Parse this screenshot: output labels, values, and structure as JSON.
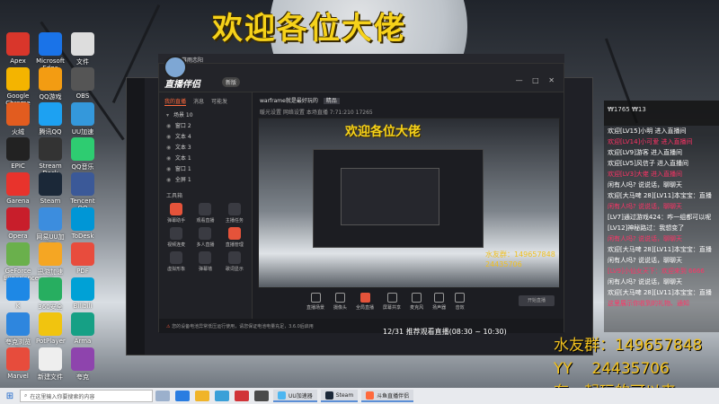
{
  "overlay": {
    "title": "欢迎各位大佬"
  },
  "fans": {
    "group_label": "水友群：",
    "group_number": "149657848",
    "yy_label": "YY",
    "yy_number": "24435706",
    "slogan": "有一起玩的可以来"
  },
  "chat": {
    "header": "₩1765 ₩13",
    "messages": [
      "欢迎[LV15]小明 进入直播间",
      "欢迎[LV14]小可爱 进入直播间",
      "欢迎[LV9]游客 进入直播间",
      "欢迎[LV5]风信子 进入直播间",
      "欢迎[LV3]大佬 进入直播间",
      "闲有人吗? 说说话，聊聊天",
      "欢迎[大马啤 28][LV11]本宝宝：直播",
      "闲有人吗? 说说话，聊聊天",
      "[LV7]通过游戏424：咋一组都可以呢",
      "[LV12]神秘路过：我想变了",
      "闲有人吗? 说说话，聊聊天",
      "欢迎[大马啤 28][LV11]本宝宝：直播",
      "闲有人吗? 说说话，聊聊天",
      "[LV9]小仙女天下：欢迎来到 6666",
      "闲有人吗? 说说话，聊聊天",
      "欢迎[大马啤 28][LV11]本宝宝：直播",
      "这里展示你收到的礼物、通知"
    ]
  },
  "desktop": {
    "icons": [
      "Apex",
      "Google Chrome",
      "火绒",
      "EPIC",
      "Garena",
      "Opera",
      "GeForce Experience",
      "K",
      "夸克浏览器",
      "Marvel",
      "Microsoft Edge",
      "QQ游戏",
      "腾讯QQ",
      "Stream Deck",
      "Steam",
      "网易UU加速器",
      "迅游加速器",
      "360安全",
      "PotPlayer",
      "新建文件",
      "文件",
      "OBS",
      "UU加速",
      "QQ音乐",
      "Tencent QQ",
      "ToDesk",
      "PDF",
      "Bilibili",
      "Arma",
      "夸克"
    ]
  },
  "app": {
    "account_name": "暮雨恋阳",
    "account_sub": "ID:9527",
    "logo": "直播伴侣",
    "logo_badge": "新版",
    "header_controls": "— □ ✕",
    "left_tabs": [
      "我的直播",
      "消息",
      "可能发"
    ],
    "scene_label": "场景 10",
    "sources": [
      "窗口 2",
      "文本 4",
      "文本 3",
      "文本 1",
      "窗口 1",
      "全屏 1"
    ],
    "tools_title": "工具箱",
    "tools": [
      "弹幕助手",
      "观看直播",
      "主播任务",
      "视频连麦",
      "多人直播",
      "直播管理",
      "虚拟形象",
      "弹幕墙",
      "歌词显示"
    ],
    "stream_title": "warframe就是最好玩的",
    "stream_badge": "精品",
    "stream_meta": [
      "暖光设置",
      "网络设置",
      "本场直播",
      "7:71:210",
      "17265"
    ],
    "bottom_tools": [
      "直播场景",
      "摄像头",
      "全局直播",
      "屏幕共享",
      "麦克风",
      "扬声器",
      "音效"
    ],
    "start_button": "开始直播",
    "status_warning": "您的设备电池异常低压运行使用，请您保证电池电量充足，3.6.0后启用",
    "ticker": "12/31  推荐观看直播(08:30 ~ 10:30)",
    "preview_fans": [
      "水友群：149657848",
      "24435706"
    ]
  },
  "taskbar": {
    "search_placeholder": "在这里输入你要搜索的内容",
    "apps": [
      "UU加速器",
      "Steam",
      "斗鱼直播伴侣"
    ]
  }
}
